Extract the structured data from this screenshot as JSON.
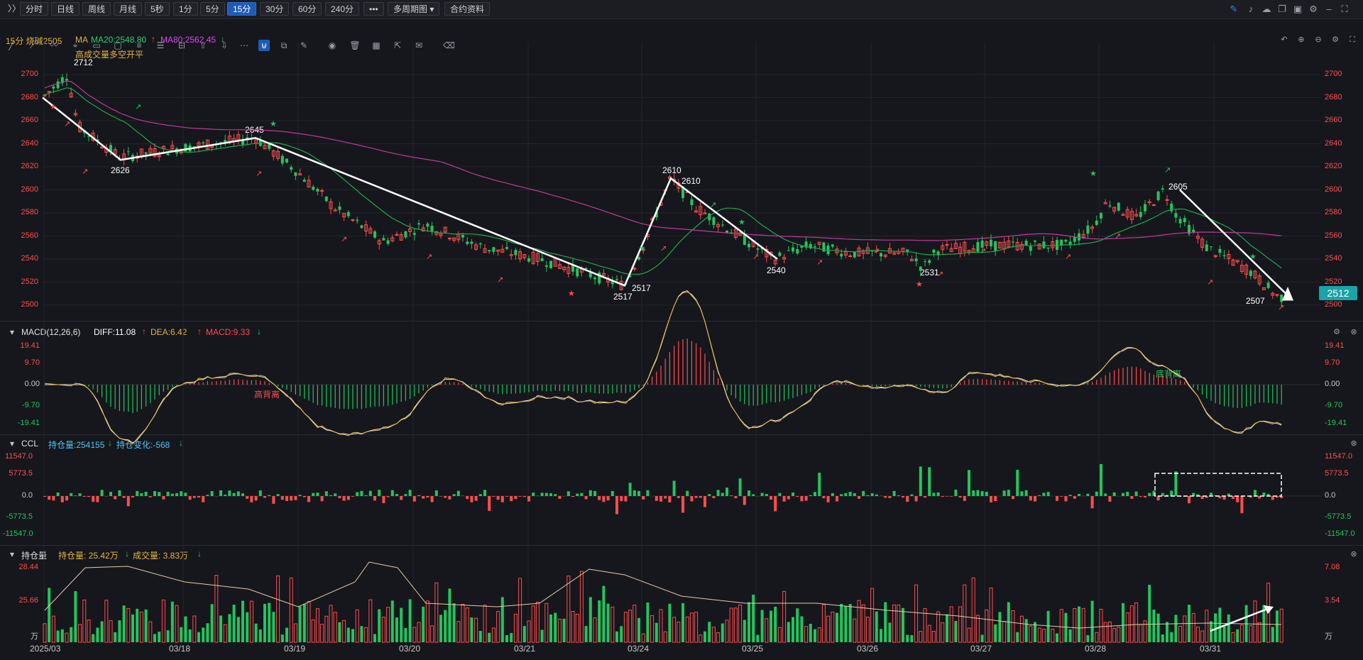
{
  "toolbar": {
    "collapse": "〉〉",
    "periods": [
      "分时",
      "日线",
      "周线",
      "月线",
      "5秒",
      "1分",
      "5分",
      "15分",
      "30分",
      "60分",
      "240分"
    ],
    "active_period": "15分",
    "more": "•••",
    "multi_period": "多周期图",
    "contract_info": "合约资料"
  },
  "main_panel": {
    "header_symbol": "15分 烧碱2505",
    "ma_label": "MA",
    "ma20": "MA20:2548.80",
    "ma80": "MA80:2562.45",
    "annotation_top": "高成交量多空开平",
    "price_tag": "2512",
    "y_ticks": [
      "2700",
      "2680",
      "2660",
      "2640",
      "2620",
      "2600",
      "2580",
      "2560",
      "2540",
      "2520",
      "2500"
    ],
    "y_tick_values": [
      2700,
      2680,
      2660,
      2640,
      2620,
      2600,
      2580,
      2560,
      2540,
      2520,
      2500
    ],
    "points": [
      {
        "label": "2712",
        "value": 2712
      },
      {
        "label": "2645",
        "value": 2645
      },
      {
        "label": "2626",
        "value": 2626
      },
      {
        "label": "2610",
        "value": 2610
      },
      {
        "label": "2610",
        "value": 2610
      },
      {
        "label": "2517",
        "value": 2517
      },
      {
        "label": "2517",
        "value": 2517
      },
      {
        "label": "2540",
        "value": 2540
      },
      {
        "label": "2531",
        "value": 2531
      },
      {
        "label": "2605",
        "value": 2605
      },
      {
        "label": "2507",
        "value": 2507
      }
    ]
  },
  "macd_panel": {
    "title": "MACD(12,26,6)",
    "diff": "DIFF:11.08",
    "dea": "DEA:6.42",
    "macd": "MACD:9.33",
    "y_ticks": [
      "19.41",
      "9.70",
      "0.00",
      "-9.70",
      "-19.41"
    ],
    "annotations": [
      "高背离",
      "底背离"
    ]
  },
  "ccl_panel": {
    "title": "CCL",
    "oi": "持仓量:254155",
    "oi_change": "持仓变化:-568",
    "y_ticks": [
      "11547.0",
      "5773.5",
      "0.0",
      "-5773.5",
      "-11547.0"
    ]
  },
  "oi_panel": {
    "title": "持仓量",
    "oi": "持仓量: 25.42万",
    "volume": "成交量: 3.83万",
    "y_ticks_left": [
      "28.44",
      "25.66",
      "万"
    ],
    "y_ticks_right": [
      "7.08",
      "3.54",
      "万"
    ]
  },
  "x_axis": [
    "2025/03",
    "03/18",
    "03/19",
    "03/20",
    "03/21",
    "03/24",
    "03/25",
    "03/26",
    "03/27",
    "03/28",
    "03/31"
  ],
  "colors": {
    "up": "#ff4d4f",
    "down": "#22c55e",
    "ma20": "#1fa84f",
    "ma80": "#c0399a",
    "accent": "#1e5bb5",
    "price_tag": "#1aa3a8"
  }
}
